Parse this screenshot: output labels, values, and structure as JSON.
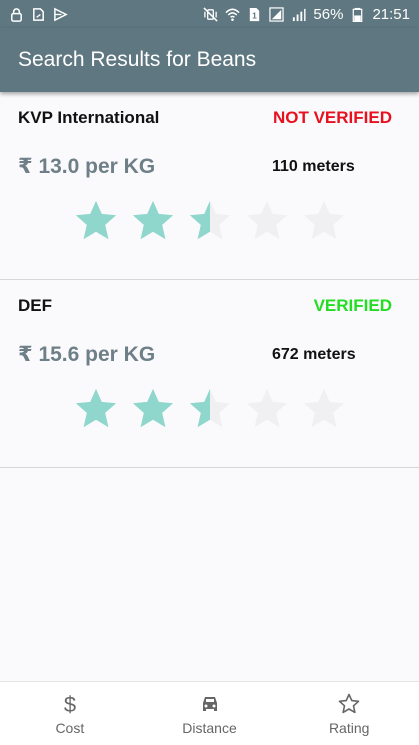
{
  "status_bar": {
    "battery_percent": "56%",
    "time": "21:51",
    "left_icons": [
      "lock-icon",
      "sim-card-icon",
      "message-arrow-icon"
    ],
    "right_icons": [
      "mute-vibrate-icon",
      "wifi-icon",
      "sim-1-icon",
      "signal-icon",
      "signal-2-icon",
      "battery-icon"
    ]
  },
  "app_bar": {
    "title": "Search Results for Beans"
  },
  "colors": {
    "primary": "#5f7780",
    "verified": "#22dd22",
    "not_verified": "#e8101e",
    "star_filled": "#8fd6cc",
    "star_empty": "#f0f0f2"
  },
  "results": [
    {
      "name": "KVP International",
      "status": "NOT VERIFIED",
      "status_color": "#e8101e",
      "price": "₹ 13.0 per KG",
      "distance": "110 meters",
      "rating": 2.5,
      "rating_max": 5
    },
    {
      "name": "DEF",
      "status": "VERIFIED",
      "status_color": "#22dd22",
      "price": "₹ 15.6 per KG",
      "distance": "672 meters",
      "rating": 2.5,
      "rating_max": 5
    }
  ],
  "bottom_nav": {
    "items": [
      {
        "label": "Cost",
        "icon": "dollar-icon"
      },
      {
        "label": "Distance",
        "icon": "car-icon"
      },
      {
        "label": "Rating",
        "icon": "star-outline-icon"
      }
    ]
  }
}
